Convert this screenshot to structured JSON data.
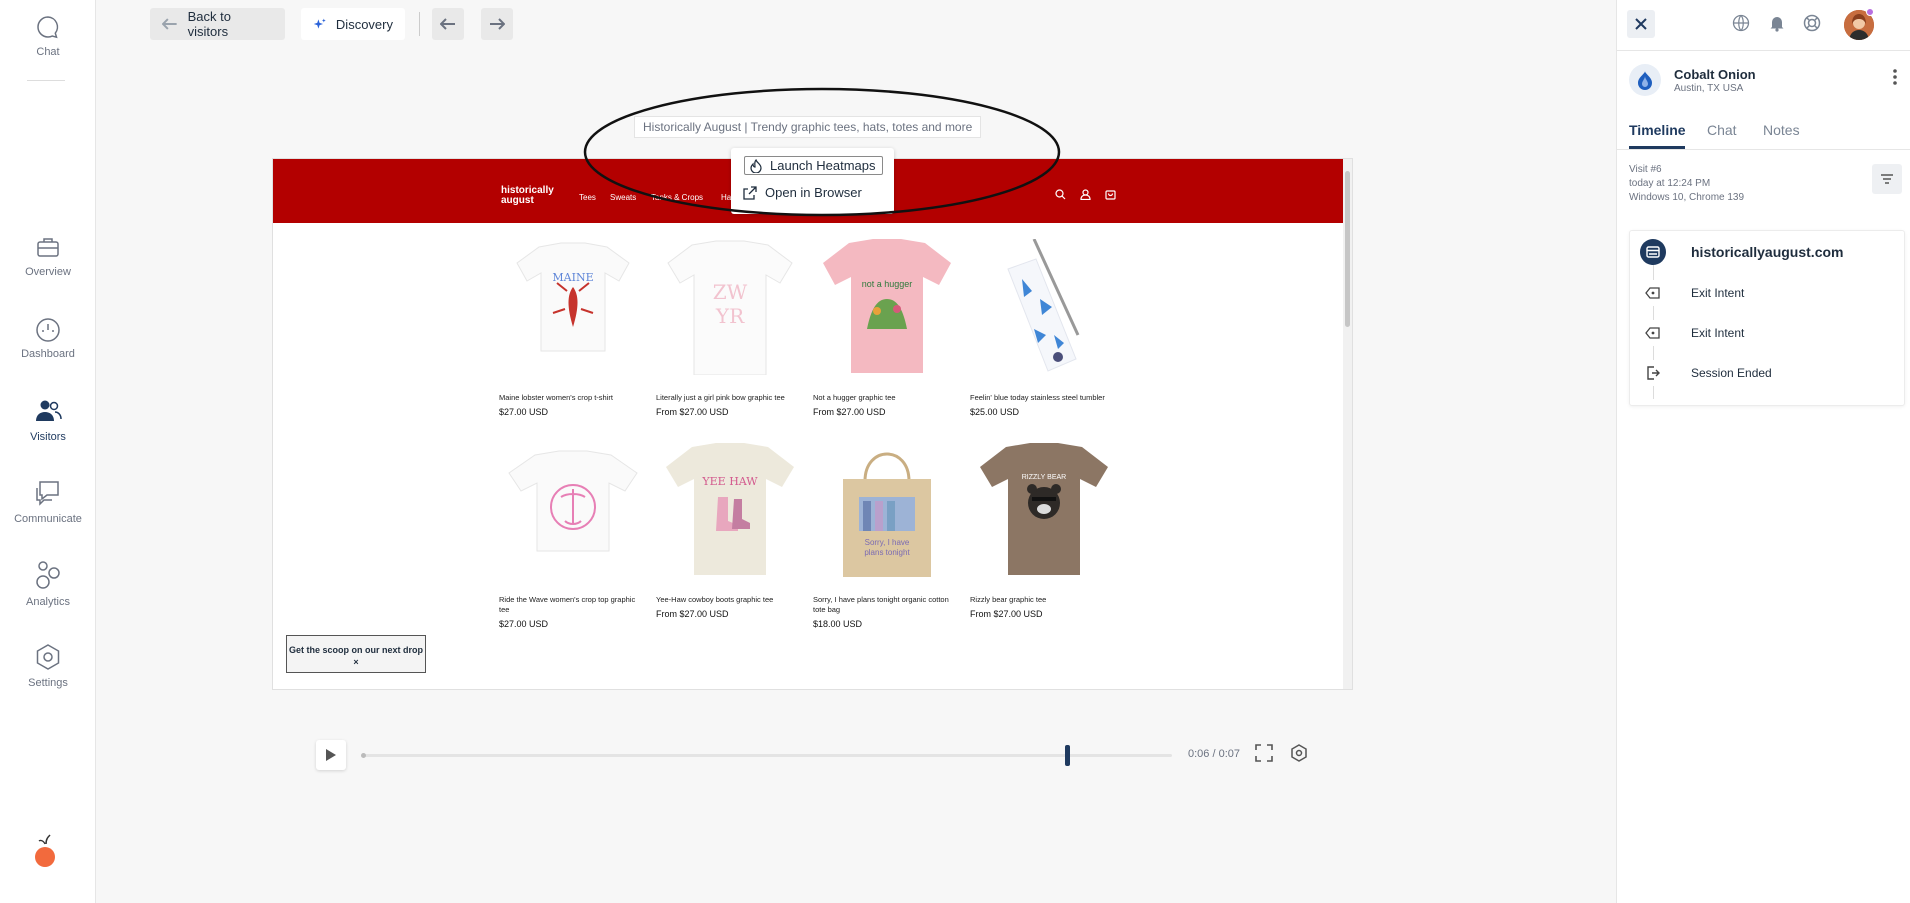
{
  "sidebar": {
    "items": [
      {
        "label": "Chat",
        "icon": "chat-bubble-icon"
      },
      {
        "label": "Overview",
        "icon": "briefcase-icon"
      },
      {
        "label": "Dashboard",
        "icon": "gauge-icon"
      },
      {
        "label": "Visitors",
        "icon": "people-icon"
      },
      {
        "label": "Communicate",
        "icon": "messages-icon"
      },
      {
        "label": "Analytics",
        "icon": "analytics-icon"
      },
      {
        "label": "Settings",
        "icon": "hexagon-gear-icon"
      }
    ],
    "active": "Visitors"
  },
  "toolbar": {
    "back_label": "Back to visitors",
    "discovery_label": "Discovery"
  },
  "page_title": "Historically August | Trendy graphic tees, hats, totes and more",
  "menu": {
    "launch_heatmaps": "Launch Heatmaps",
    "open_in_browser": "Open in Browser"
  },
  "site": {
    "logo_line1": "historically",
    "logo_line2": "august",
    "nav": [
      "Tees",
      "Sweats",
      "Tanks & Crops",
      "Ha"
    ],
    "products": [
      {
        "name": "Maine lobster women's crop t-shirt",
        "price": "$27.00 USD"
      },
      {
        "name": "Literally just a girl pink bow graphic tee",
        "price": "From $27.00 USD"
      },
      {
        "name": "Not a hugger graphic tee",
        "price": "From $27.00 USD"
      },
      {
        "name": "Feelin' blue today stainless steel tumbler",
        "price": "$25.00 USD"
      },
      {
        "name": "Ride the Wave women's crop top graphic tee",
        "price": "$27.00 USD"
      },
      {
        "name": "Yee-Haw cowboy boots graphic tee",
        "price": "From $27.00 USD"
      },
      {
        "name": "Sorry, I have plans tonight organic cotton tote bag",
        "price": "$18.00 USD"
      },
      {
        "name": "Rizzly bear graphic tee",
        "price": "From $27.00 USD"
      }
    ],
    "popup_title": "Get the scoop on our next drop",
    "popup_close": "×"
  },
  "player": {
    "time": "0:06 / 0:07",
    "progress": 0.87
  },
  "visitor": {
    "name": "Cobalt Onion",
    "location": "Austin, TX USA"
  },
  "tabs": [
    "Timeline",
    "Chat",
    "Notes"
  ],
  "visit": {
    "number": "Visit #6",
    "time": "today at 12:24 PM",
    "env": "Windows 10, Chrome 139"
  },
  "timeline": [
    {
      "label": "historicallyaugust.com",
      "icon": "browser-window-icon"
    },
    {
      "label": "Exit Intent",
      "icon": "exit-intent-icon"
    },
    {
      "label": "Exit Intent",
      "icon": "exit-intent-icon"
    },
    {
      "label": "Session Ended",
      "icon": "session-ended-icon"
    }
  ],
  "colors": {
    "accent": "#1f3a5f",
    "site_header": "#b30000",
    "avatar_status": "#b76fe0",
    "logo_orange": "#f26a3d"
  }
}
